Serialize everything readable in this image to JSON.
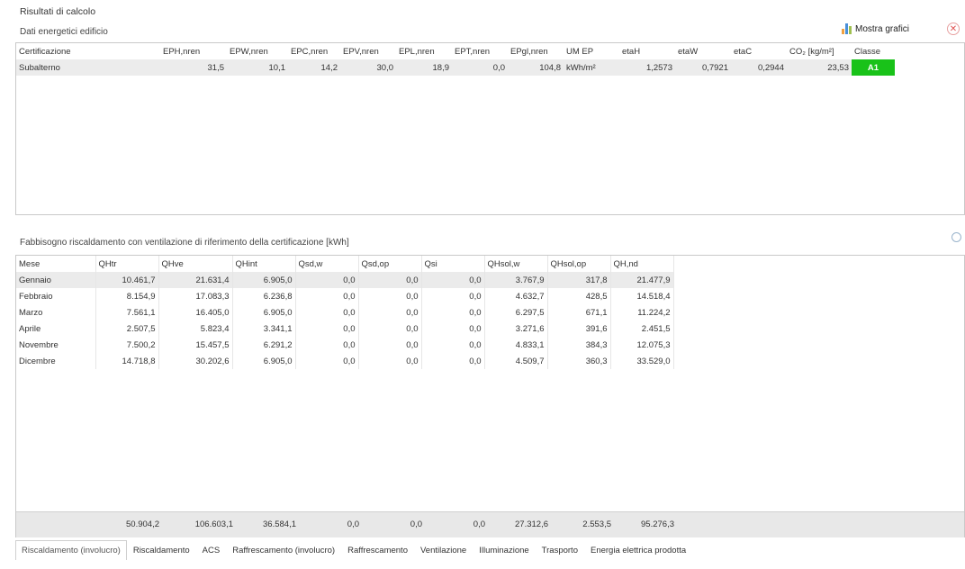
{
  "header": {
    "title": "Risultati di calcolo",
    "subtitle": "Dati energetici edificio",
    "chart_button_label": "Mostra grafici"
  },
  "table1": {
    "columns": [
      "Certificazione",
      "EPH,nren",
      "EPW,nren",
      "EPC,nren",
      "EPV,nren",
      "EPL,nren",
      "EPT,nren",
      "EPgl,nren",
      "UM EP",
      "etaH",
      "etaW",
      "etaC",
      "CO₂ [kg/m²]",
      "Classe"
    ],
    "rows": [
      [
        "Subalterno",
        "31,5",
        "10,1",
        "14,2",
        "30,0",
        "18,9",
        "0,0",
        "104,8",
        "kWh/m²",
        "1,2573",
        "0,7921",
        "0,2944",
        "23,53",
        "A1"
      ]
    ]
  },
  "section2": {
    "title": "Fabbisogno riscaldamento con ventilazione di riferimento della certificazione [kWh]"
  },
  "table2": {
    "columns": [
      "Mese",
      "QHtr",
      "QHve",
      "QHint",
      "Qsd,w",
      "Qsd,op",
      "Qsi",
      "QHsol,w",
      "QHsol,op",
      "QH,nd"
    ],
    "rows": [
      [
        "Gennaio",
        "10.461,7",
        "21.631,4",
        "6.905,0",
        "0,0",
        "0,0",
        "0,0",
        "3.767,9",
        "317,8",
        "21.477,9"
      ],
      [
        "Febbraio",
        "8.154,9",
        "17.083,3",
        "6.236,8",
        "0,0",
        "0,0",
        "0,0",
        "4.632,7",
        "428,5",
        "14.518,4"
      ],
      [
        "Marzo",
        "7.561,1",
        "16.405,0",
        "6.905,0",
        "0,0",
        "0,0",
        "0,0",
        "6.297,5",
        "671,1",
        "11.224,2"
      ],
      [
        "Aprile",
        "2.507,5",
        "5.823,4",
        "3.341,1",
        "0,0",
        "0,0",
        "0,0",
        "3.271,6",
        "391,6",
        "2.451,5"
      ],
      [
        "Novembre",
        "7.500,2",
        "15.457,5",
        "6.291,2",
        "0,0",
        "0,0",
        "0,0",
        "4.833,1",
        "384,3",
        "12.075,3"
      ],
      [
        "Dicembre",
        "14.718,8",
        "30.202,6",
        "6.905,0",
        "0,0",
        "0,0",
        "0,0",
        "4.509,7",
        "360,3",
        "33.529,0"
      ]
    ],
    "totals": [
      "50.904,2",
      "106.603,1",
      "36.584,1",
      "0,0",
      "0,0",
      "0,0",
      "27.312,6",
      "2.553,5",
      "95.276,3"
    ]
  },
  "tabs": [
    "Riscaldamento (involucro)",
    "Riscaldamento",
    "ACS",
    "Raffrescamento (involucro)",
    "Raffrescamento",
    "Ventilazione",
    "Illuminazione",
    "Trasporto",
    "Energia elettrica prodotta"
  ],
  "active_tab": 0,
  "colors": {
    "classe_badge": "#19c219",
    "chart_icon": [
      "#f0a040",
      "#4a90d9",
      "#a0c050"
    ],
    "close_icon": "#e05050"
  },
  "icons": {
    "chart": "bar-chart-icon",
    "close": "close-icon",
    "refresh": "refresh-icon"
  }
}
